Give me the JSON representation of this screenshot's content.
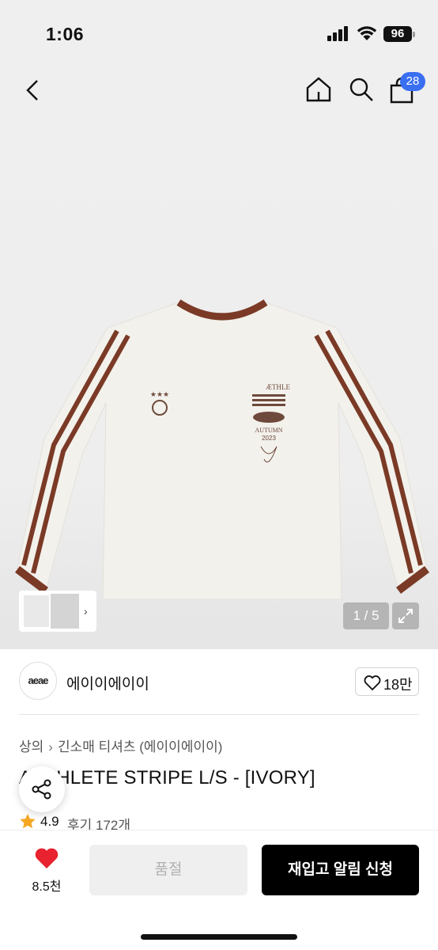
{
  "status_bar": {
    "time": "1:06",
    "battery": "96"
  },
  "header": {
    "cart_count": "28"
  },
  "gallery": {
    "page_indicator": "1 / 5",
    "print": {
      "line1": "ÆTHLE",
      "line2": "AUTUMN",
      "line3": "2023"
    },
    "colors": {
      "shirt": "#f1efea",
      "trim": "#7a3a26",
      "print": "#6e4a3c"
    }
  },
  "brand": {
    "logo_text": "aeae",
    "name": "에이이에이이",
    "like_count": "18만"
  },
  "breadcrumb": {
    "root": "상의",
    "category": "긴소매 티셔츠 (에이이에이이)"
  },
  "product": {
    "title": "AETHLETE STRIPE L/S - [IVORY]",
    "rating": "4.9",
    "reviews_label": "후기 172개"
  },
  "bottom_bar": {
    "wish_count": "8.5천",
    "sold_out_label": "품절",
    "restock_label": "재입고 알림 신청"
  },
  "colors": {
    "accent_blue": "#3a6ff2",
    "heart_red": "#e8222e",
    "star_orange": "#f5a623"
  }
}
